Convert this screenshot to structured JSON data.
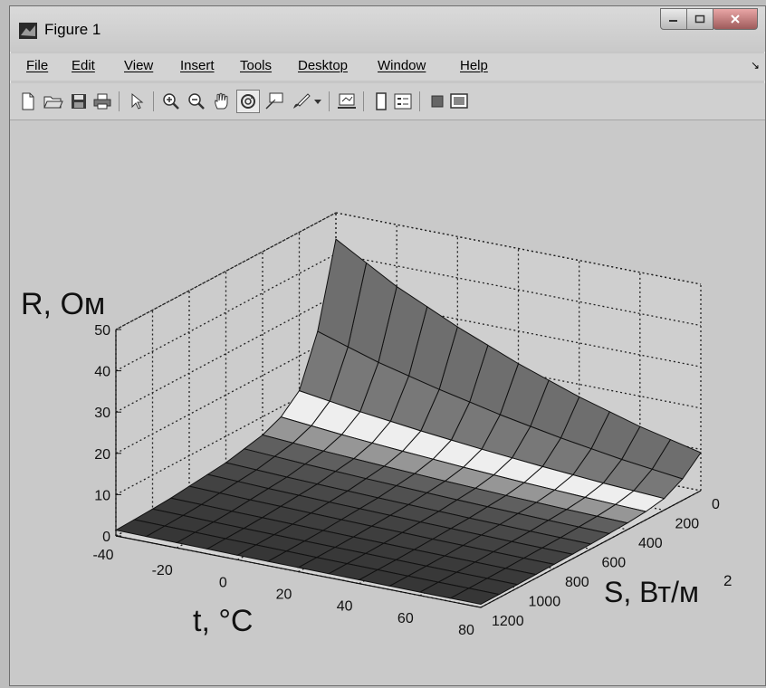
{
  "window": {
    "title": "Figure 1"
  },
  "menu": [
    "File",
    "Edit",
    "View",
    "Insert",
    "Tools",
    "Desktop",
    "Window",
    "Help"
  ],
  "toolbar": {
    "buttons": [
      "new-figure",
      "open-file",
      "save-figure",
      "print-figure",
      "edit-plot",
      "zoom-in",
      "zoom-out",
      "pan",
      "rotate-3d",
      "data-cursor",
      "brush",
      "link-plot",
      "colorbar",
      "legend",
      "hide-plot-tools",
      "show-plot-tools"
    ],
    "active": "rotate-3d"
  },
  "chart_data": {
    "type": "surface",
    "zlabel": "R, Ом",
    "xlabel": "t, °C",
    "ylabel": "S, Вт/м",
    "ylabel_sup": "2",
    "x_ticks": [
      "-40",
      "-20",
      "0",
      "20",
      "40",
      "60",
      "80"
    ],
    "y_ticks": [
      "0",
      "200",
      "400",
      "600",
      "800",
      "1000",
      "1200"
    ],
    "z_ticks": [
      "0",
      "10",
      "20",
      "30",
      "40",
      "50"
    ],
    "xlim": [
      -40,
      80
    ],
    "ylim": [
      0,
      1200
    ],
    "zlim": [
      0,
      50
    ],
    "grid": true,
    "surface": {
      "t": [
        -40,
        -30,
        -20,
        -10,
        0,
        10,
        20,
        30,
        40,
        50,
        60,
        70,
        80
      ],
      "S": [
        0,
        100,
        200,
        300,
        400,
        500,
        600,
        700,
        800,
        900,
        1000,
        1100,
        1200
      ],
      "R_profile_vs_S": [
        43,
        23,
        11,
        7,
        5,
        4,
        3,
        2.5,
        2,
        1.5,
        1.2,
        1,
        0.8
      ],
      "R_temperature_factor": [
        1.0,
        0.9,
        0.8,
        0.72,
        0.64,
        0.57,
        0.5,
        0.44,
        0.38,
        0.33,
        0.28,
        0.24,
        0.2
      ]
    }
  }
}
